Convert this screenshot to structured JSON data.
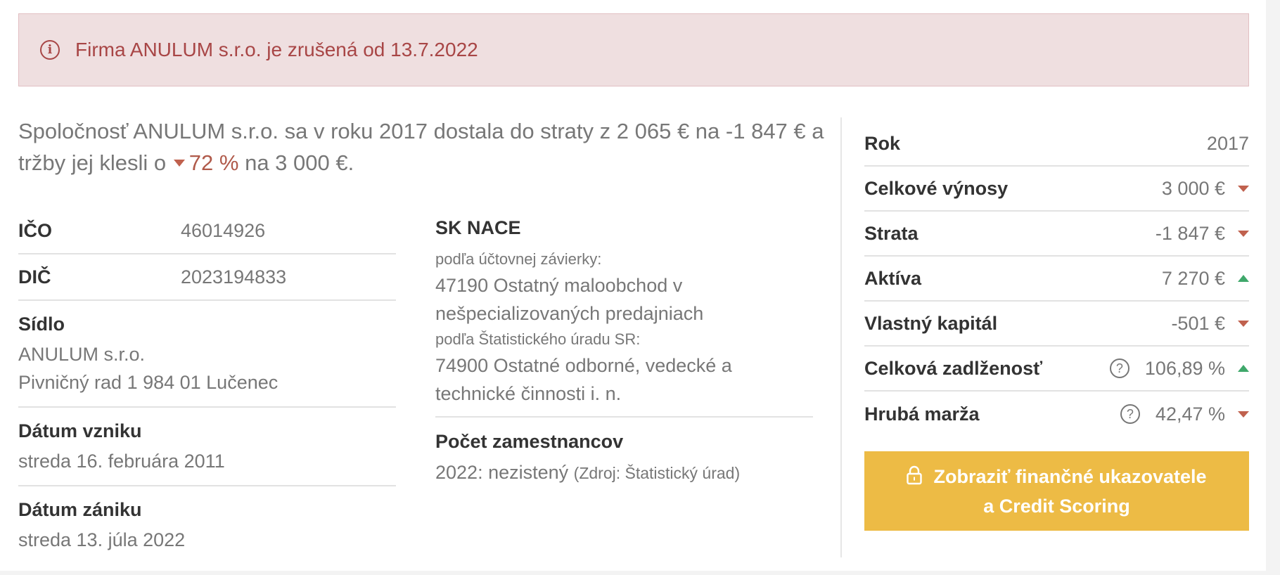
{
  "alert": {
    "text": "Firma ANULUM s.r.o. je zrušená od 13.7.2022",
    "icon": "info-icon",
    "color": "#a84646"
  },
  "summary": {
    "part1": "Spoločnosť ANULUM s.r.o. sa v roku 2017 dostala do straty z 2 065 € na -1 847 € a tržby jej klesli o ",
    "drop": "72 %",
    "part2": " na 3 000 €."
  },
  "info": {
    "ico_label": "IČO",
    "ico_value": "46014926",
    "dic_label": "DIČ",
    "dic_value": "2023194833",
    "sidlo_label": "Sídlo",
    "sidlo_line1": "ANULUM s.r.o.",
    "sidlo_line2": "Pivničný rad 1 984 01 Lučenec",
    "vznik_label": "Dátum vzniku",
    "vznik_value": "streda 16. februára 2011",
    "zanik_label": "Dátum zániku",
    "zanik_value": "streda 13. júla 2022"
  },
  "nace": {
    "label": "SK NACE",
    "sub1": "podľa účtovnej závierky:",
    "val1": "47190 Ostatný maloobchod v nešpecializovaných predajniach",
    "sub2": "podľa Štatistického úradu SR:",
    "val2": "74900 Ostatné odborné, vedecké a technické činnosti i. n.",
    "employees_label": "Počet zamestnancov",
    "employees_value": "2022: nezistený",
    "employees_source": "(Zdroj: Štatistický úrad)"
  },
  "stats": [
    {
      "label": "Rok",
      "value": "2017",
      "trend": "none",
      "help": false
    },
    {
      "label": "Celkové výnosy",
      "value": "3 000 €",
      "trend": "down",
      "help": false
    },
    {
      "label": "Strata",
      "value": "-1 847 €",
      "trend": "down",
      "help": false
    },
    {
      "label": "Aktíva",
      "value": "7 270 €",
      "trend": "up",
      "help": false
    },
    {
      "label": "Vlastný kapitál",
      "value": "-501 €",
      "trend": "down",
      "help": false
    },
    {
      "label": "Celková zadlženosť",
      "value": "106,89 %",
      "trend": "up",
      "help": true
    },
    {
      "label": "Hrubá marža",
      "value": "42,47 %",
      "trend": "down",
      "help": true
    }
  ],
  "cta": {
    "line1": "Zobraziť finančné ukazovatele",
    "line2": "a Credit Scoring",
    "icon": "lock-icon",
    "color": "#edbb45"
  },
  "colors": {
    "trend_down": "#c0614e",
    "trend_up": "#3fa86b"
  }
}
